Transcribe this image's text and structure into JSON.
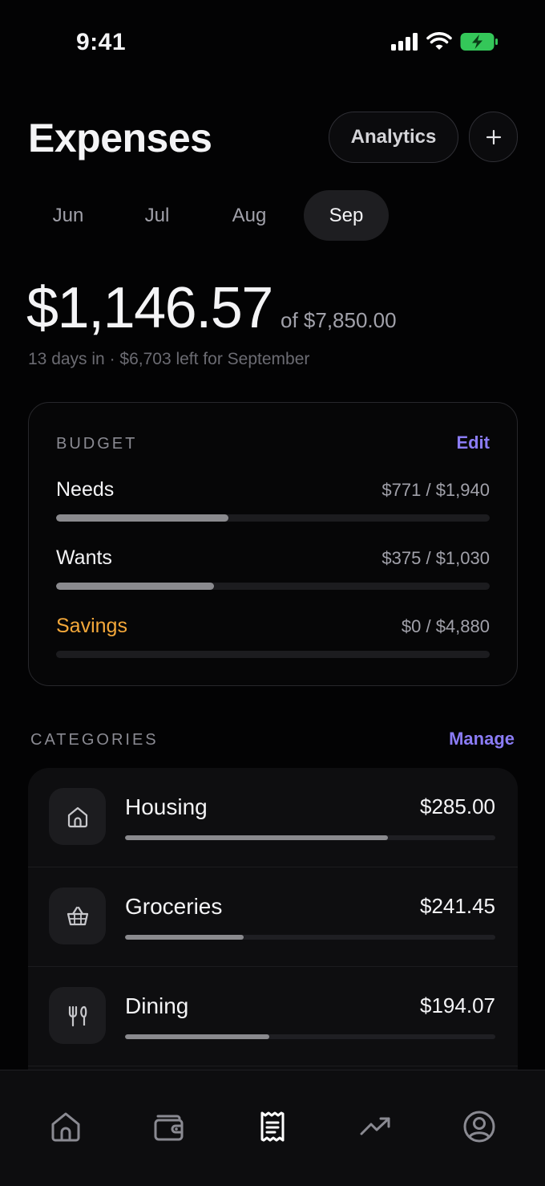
{
  "status_bar": {
    "time": "9:41"
  },
  "header": {
    "title": "Expenses",
    "analytics_label": "Analytics",
    "add_label": "+"
  },
  "months": [
    {
      "label": "Jun",
      "active": false
    },
    {
      "label": "Jul",
      "active": false
    },
    {
      "label": "Aug",
      "active": false
    },
    {
      "label": "Sep",
      "active": true
    }
  ],
  "summary": {
    "spent": "$1,146.57",
    "of_total": "of $7,850.00",
    "subtitle": "13 days in · $6,703 left for September"
  },
  "budget": {
    "label": "BUDGET",
    "edit_label": "Edit",
    "rows": [
      {
        "name": "Needs",
        "value": "$771 / $1,940",
        "progress": 0.397
      },
      {
        "name": "Wants",
        "value": "$375 / $1,030",
        "progress": 0.364
      },
      {
        "name": "Savings",
        "value": "$0 / $4,880",
        "progress": 0.0
      }
    ]
  },
  "categories": {
    "label": "CATEGORIES",
    "manage_label": "Manage",
    "items": [
      {
        "name": "Housing",
        "amount": "$285.00",
        "icon": "home-icon",
        "progress": 0.71
      },
      {
        "name": "Groceries",
        "amount": "$241.45",
        "icon": "basket-icon",
        "progress": 0.32
      },
      {
        "name": "Dining",
        "amount": "$194.07",
        "icon": "utensils-icon",
        "progress": 0.39
      }
    ]
  },
  "tab_bar": {
    "items": [
      {
        "icon": "home-icon",
        "active": false
      },
      {
        "icon": "wallet-icon",
        "active": false
      },
      {
        "icon": "receipt-icon",
        "active": true
      },
      {
        "icon": "trending-up-icon",
        "active": false
      },
      {
        "icon": "profile-icon",
        "active": false
      }
    ]
  },
  "colors": {
    "accent": "#8b7cf6",
    "savings": "#f4a83a",
    "battery": "#34c759",
    "background": "#030304"
  }
}
